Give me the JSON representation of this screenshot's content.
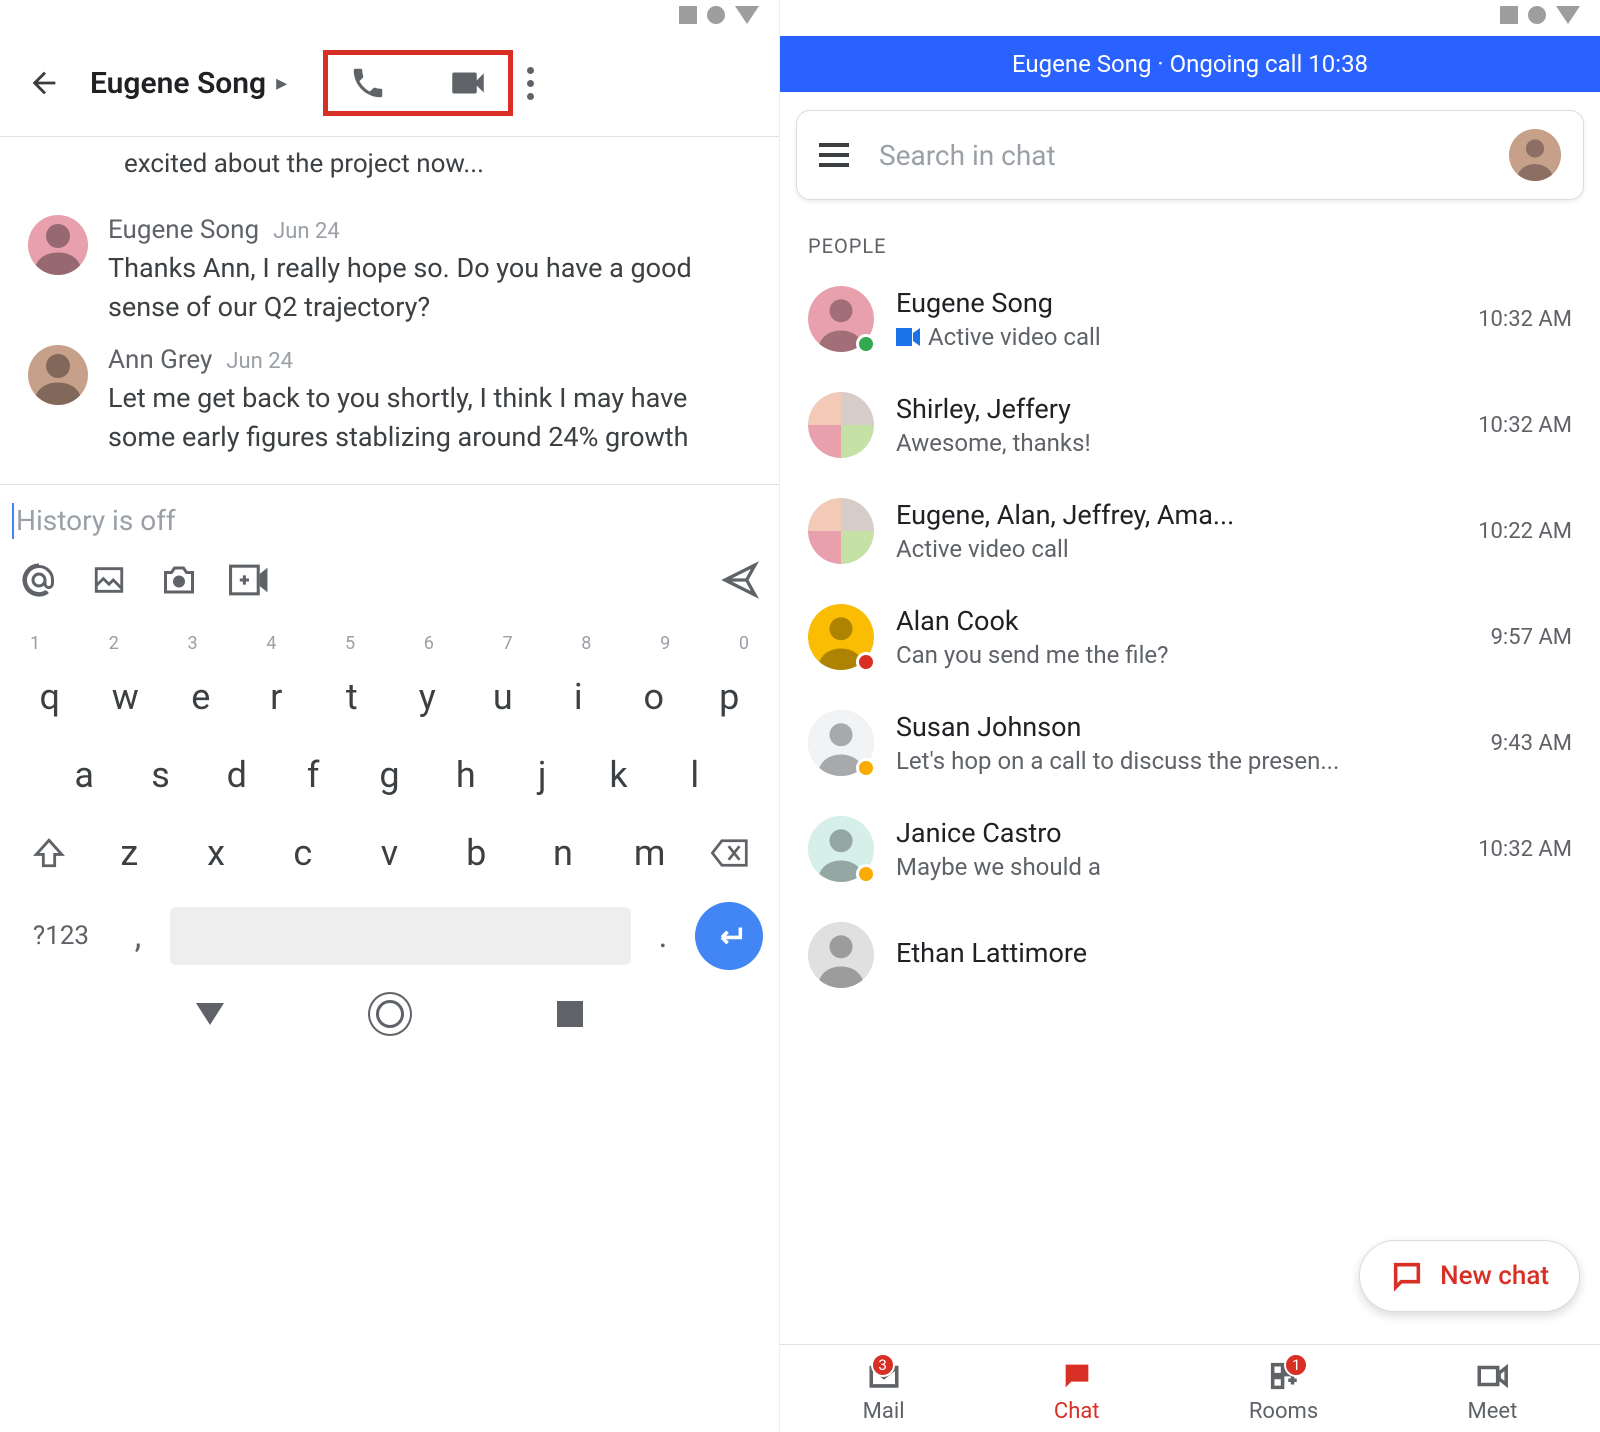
{
  "left": {
    "contact": "Eugene Song",
    "truncated_top": "excited about the project now...",
    "messages": [
      {
        "name": "Eugene Song",
        "date": "Jun 24",
        "text": "Thanks Ann, I really hope so. Do you have a good sense of our Q2 trajectory?",
        "avatar_bg": "#e8a0ac"
      },
      {
        "name": "Ann Grey",
        "date": "Jun 24",
        "text": "Let me get back to you shortly, I think I may have some early figures stablizing around 24% growth",
        "avatar_bg": "#c7a08a"
      }
    ],
    "compose_placeholder": "History is off",
    "keyboard": {
      "nums": [
        "1",
        "2",
        "3",
        "4",
        "5",
        "6",
        "7",
        "8",
        "9",
        "0"
      ],
      "row1": [
        "q",
        "w",
        "e",
        "r",
        "t",
        "y",
        "u",
        "i",
        "o",
        "p"
      ],
      "row2": [
        "a",
        "s",
        "d",
        "f",
        "g",
        "h",
        "j",
        "k",
        "l"
      ],
      "row3": [
        "z",
        "x",
        "c",
        "v",
        "b",
        "n",
        "m"
      ],
      "switch": "?123",
      "comma": ",",
      "period": "."
    }
  },
  "right": {
    "banner": "Eugene Song · Ongoing call 10:38",
    "search_placeholder": "Search in chat",
    "section_label": "PEOPLE",
    "fab_label": "New chat",
    "people": [
      {
        "name": "Eugene Song",
        "sub": "Active video call",
        "time": "10:32 AM",
        "badge": "online",
        "video": true,
        "avatar_bg": "#e8a0ac",
        "grid": false
      },
      {
        "name": "Shirley, Jeffery",
        "sub": "Awesome, thanks!",
        "time": "10:32 AM",
        "badge": "",
        "video": false,
        "avatar_bg": "#f3d1c7",
        "grid": true
      },
      {
        "name": "Eugene, Alan, Jeffrey, Ama...",
        "sub": "Active video call",
        "time": "10:22 AM",
        "badge": "",
        "video": false,
        "avatar_bg": "#e0e0e0",
        "grid": true
      },
      {
        "name": "Alan Cook",
        "sub": "Can you send me the file?",
        "time": "9:57 AM",
        "badge": "busy",
        "video": false,
        "avatar_bg": "#fbbc04",
        "grid": false
      },
      {
        "name": "Susan Johnson",
        "sub": "Let's hop on a call to discuss the presen...",
        "time": "9:43 AM",
        "badge": "away",
        "video": false,
        "avatar_bg": "#f1f3f4",
        "grid": false
      },
      {
        "name": "Janice Castro",
        "sub": "Maybe we should a",
        "time": "10:32 AM",
        "badge": "away",
        "video": false,
        "avatar_bg": "#d6f0e9",
        "grid": false
      },
      {
        "name": "Ethan Lattimore",
        "sub": "",
        "time": "",
        "badge": "",
        "video": false,
        "avatar_bg": "#e0e0e0",
        "grid": false
      }
    ],
    "nav": {
      "items": [
        {
          "label": "Mail",
          "badge": "3",
          "active": false
        },
        {
          "label": "Chat",
          "badge": "",
          "active": true
        },
        {
          "label": "Rooms",
          "badge": "1",
          "active": false
        },
        {
          "label": "Meet",
          "badge": "",
          "active": false
        }
      ]
    }
  }
}
